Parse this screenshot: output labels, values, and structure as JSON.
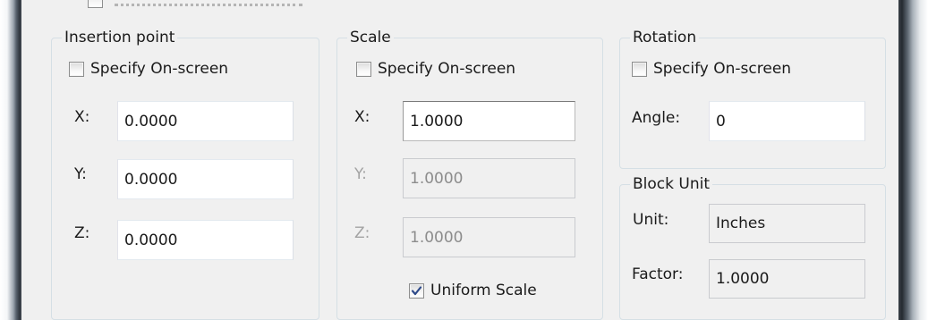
{
  "insertion_point": {
    "title": "Insertion point",
    "specify_label": "Specify On-screen",
    "specify_checked": false,
    "x_label": "X:",
    "x_value": "0.0000",
    "y_label": "Y:",
    "y_value": "0.0000",
    "z_label": "Z:",
    "z_value": "0.0000"
  },
  "scale": {
    "title": "Scale",
    "specify_label": "Specify On-screen",
    "specify_checked": false,
    "x_label": "X:",
    "x_value": "1.0000",
    "y_label": "Y:",
    "y_value": "1.0000",
    "z_label": "Z:",
    "z_value": "1.0000",
    "uniform_label": "Uniform Scale",
    "uniform_checked": true
  },
  "rotation": {
    "title": "Rotation",
    "specify_label": "Specify On-screen",
    "specify_checked": false,
    "angle_label": "Angle:",
    "angle_value": "0"
  },
  "block_unit": {
    "title": "Block Unit",
    "unit_label": "Unit:",
    "unit_value": "Inches",
    "factor_label": "Factor:",
    "factor_value": "1.0000"
  },
  "icons": {
    "checkmark": "checkmark-icon"
  },
  "colors": {
    "dialog_bg": "#f0f0f0",
    "group_border": "#d5dfe5",
    "check_color": "#2e4a8a",
    "disabled_text": "#a3a3a3"
  }
}
